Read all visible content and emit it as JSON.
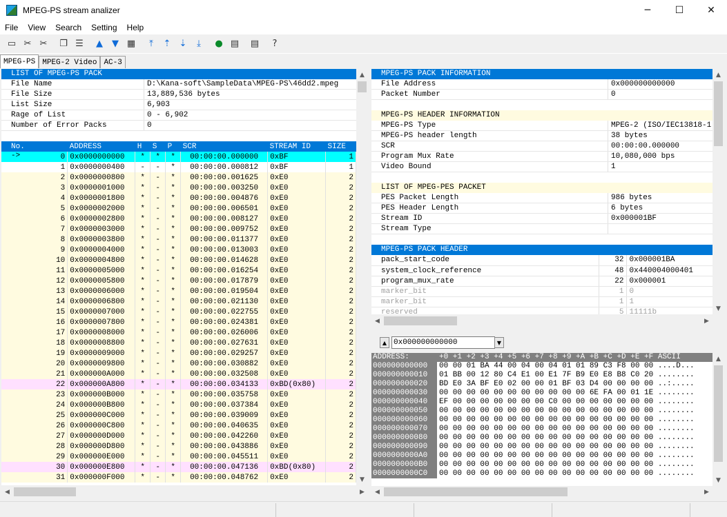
{
  "window": {
    "title": "MPEG-PS stream analizer",
    "minimize": "─",
    "maximize": "☐",
    "close": "✕"
  },
  "menu": [
    "File",
    "View",
    "Search",
    "Setting",
    "Help"
  ],
  "tabs": [
    "MPEG-PS",
    "MPEG-2 Video",
    "AC-3"
  ],
  "list": {
    "header": "LIST OF MPEG-PS PACK",
    "rows": [
      {
        "k": "File Name",
        "v": "D:\\Kana-soft\\SampleData\\MPEG-PS\\46dd2.mpeg"
      },
      {
        "k": "File Size",
        "v": "13,889,536 bytes"
      },
      {
        "k": "List Size",
        "v": "6,903"
      },
      {
        "k": "Rage of List",
        "v": "0 - 6,902"
      },
      {
        "k": "Number of Error Packs",
        "v": "0"
      }
    ]
  },
  "packets": {
    "columns": [
      "No.",
      "ADDRESS",
      "H",
      "S",
      "P",
      "SCR",
      "STREAM ID",
      "SIZE"
    ],
    "rows": [
      {
        "mark": "->",
        "no": "0",
        "addr": "0x0000000000",
        "h": "*",
        "s": "*",
        "p": "*",
        "scr": "00:00:00.000000",
        "sid": "0xBF",
        "size": "1",
        "style": "cur"
      },
      {
        "mark": "",
        "no": "1",
        "addr": "0x0000000400",
        "h": "-",
        "s": "-",
        "p": "*",
        "scr": "00:00:00.000812",
        "sid": "0xBF",
        "size": "1",
        "style": "wht"
      },
      {
        "mark": "",
        "no": "2",
        "addr": "0x0000000800",
        "h": "*",
        "s": "-",
        "p": "*",
        "scr": "00:00:00.001625",
        "sid": "0xE0",
        "size": "2",
        "style": ""
      },
      {
        "mark": "",
        "no": "3",
        "addr": "0x0000001000",
        "h": "*",
        "s": "-",
        "p": "*",
        "scr": "00:00:00.003250",
        "sid": "0xE0",
        "size": "2",
        "style": ""
      },
      {
        "mark": "",
        "no": "4",
        "addr": "0x0000001800",
        "h": "*",
        "s": "-",
        "p": "*",
        "scr": "00:00:00.004876",
        "sid": "0xE0",
        "size": "2",
        "style": ""
      },
      {
        "mark": "",
        "no": "5",
        "addr": "0x0000002000",
        "h": "*",
        "s": "-",
        "p": "*",
        "scr": "00:00:00.006501",
        "sid": "0xE0",
        "size": "2",
        "style": ""
      },
      {
        "mark": "",
        "no": "6",
        "addr": "0x0000002800",
        "h": "*",
        "s": "-",
        "p": "*",
        "scr": "00:00:00.008127",
        "sid": "0xE0",
        "size": "2",
        "style": ""
      },
      {
        "mark": "",
        "no": "7",
        "addr": "0x0000003000",
        "h": "*",
        "s": "-",
        "p": "*",
        "scr": "00:00:00.009752",
        "sid": "0xE0",
        "size": "2",
        "style": ""
      },
      {
        "mark": "",
        "no": "8",
        "addr": "0x0000003800",
        "h": "*",
        "s": "-",
        "p": "*",
        "scr": "00:00:00.011377",
        "sid": "0xE0",
        "size": "2",
        "style": ""
      },
      {
        "mark": "",
        "no": "9",
        "addr": "0x0000004000",
        "h": "*",
        "s": "-",
        "p": "*",
        "scr": "00:00:00.013003",
        "sid": "0xE0",
        "size": "2",
        "style": ""
      },
      {
        "mark": "",
        "no": "10",
        "addr": "0x0000004800",
        "h": "*",
        "s": "-",
        "p": "*",
        "scr": "00:00:00.014628",
        "sid": "0xE0",
        "size": "2",
        "style": ""
      },
      {
        "mark": "",
        "no": "11",
        "addr": "0x0000005000",
        "h": "*",
        "s": "-",
        "p": "*",
        "scr": "00:00:00.016254",
        "sid": "0xE0",
        "size": "2",
        "style": ""
      },
      {
        "mark": "",
        "no": "12",
        "addr": "0x0000005800",
        "h": "*",
        "s": "-",
        "p": "*",
        "scr": "00:00:00.017879",
        "sid": "0xE0",
        "size": "2",
        "style": ""
      },
      {
        "mark": "",
        "no": "13",
        "addr": "0x0000006000",
        "h": "*",
        "s": "-",
        "p": "*",
        "scr": "00:00:00.019504",
        "sid": "0xE0",
        "size": "2",
        "style": ""
      },
      {
        "mark": "",
        "no": "14",
        "addr": "0x0000006800",
        "h": "*",
        "s": "-",
        "p": "*",
        "scr": "00:00:00.021130",
        "sid": "0xE0",
        "size": "2",
        "style": ""
      },
      {
        "mark": "",
        "no": "15",
        "addr": "0x0000007000",
        "h": "*",
        "s": "-",
        "p": "*",
        "scr": "00:00:00.022755",
        "sid": "0xE0",
        "size": "2",
        "style": ""
      },
      {
        "mark": "",
        "no": "16",
        "addr": "0x0000007800",
        "h": "*",
        "s": "-",
        "p": "*",
        "scr": "00:00:00.024381",
        "sid": "0xE0",
        "size": "2",
        "style": ""
      },
      {
        "mark": "",
        "no": "17",
        "addr": "0x0000008000",
        "h": "*",
        "s": "-",
        "p": "*",
        "scr": "00:00:00.026006",
        "sid": "0xE0",
        "size": "2",
        "style": ""
      },
      {
        "mark": "",
        "no": "18",
        "addr": "0x0000008800",
        "h": "*",
        "s": "-",
        "p": "*",
        "scr": "00:00:00.027631",
        "sid": "0xE0",
        "size": "2",
        "style": ""
      },
      {
        "mark": "",
        "no": "19",
        "addr": "0x0000009000",
        "h": "*",
        "s": "-",
        "p": "*",
        "scr": "00:00:00.029257",
        "sid": "0xE0",
        "size": "2",
        "style": ""
      },
      {
        "mark": "",
        "no": "20",
        "addr": "0x0000009800",
        "h": "*",
        "s": "-",
        "p": "*",
        "scr": "00:00:00.030882",
        "sid": "0xE0",
        "size": "2",
        "style": ""
      },
      {
        "mark": "",
        "no": "21",
        "addr": "0x000000A000",
        "h": "*",
        "s": "-",
        "p": "*",
        "scr": "00:00:00.032508",
        "sid": "0xE0",
        "size": "2",
        "style": ""
      },
      {
        "mark": "",
        "no": "22",
        "addr": "0x000000A800",
        "h": "*",
        "s": "-",
        "p": "*",
        "scr": "00:00:00.034133",
        "sid": "0xBD(0x80)",
        "size": "2",
        "style": "pink"
      },
      {
        "mark": "",
        "no": "23",
        "addr": "0x000000B000",
        "h": "*",
        "s": "-",
        "p": "*",
        "scr": "00:00:00.035758",
        "sid": "0xE0",
        "size": "2",
        "style": ""
      },
      {
        "mark": "",
        "no": "24",
        "addr": "0x000000B800",
        "h": "*",
        "s": "-",
        "p": "*",
        "scr": "00:00:00.037384",
        "sid": "0xE0",
        "size": "2",
        "style": ""
      },
      {
        "mark": "",
        "no": "25",
        "addr": "0x000000C000",
        "h": "*",
        "s": "-",
        "p": "*",
        "scr": "00:00:00.039009",
        "sid": "0xE0",
        "size": "2",
        "style": ""
      },
      {
        "mark": "",
        "no": "26",
        "addr": "0x000000C800",
        "h": "*",
        "s": "-",
        "p": "*",
        "scr": "00:00:00.040635",
        "sid": "0xE0",
        "size": "2",
        "style": ""
      },
      {
        "mark": "",
        "no": "27",
        "addr": "0x000000D000",
        "h": "*",
        "s": "-",
        "p": "*",
        "scr": "00:00:00.042260",
        "sid": "0xE0",
        "size": "2",
        "style": ""
      },
      {
        "mark": "",
        "no": "28",
        "addr": "0x000000D800",
        "h": "*",
        "s": "-",
        "p": "*",
        "scr": "00:00:00.043886",
        "sid": "0xE0",
        "size": "2",
        "style": ""
      },
      {
        "mark": "",
        "no": "29",
        "addr": "0x000000E000",
        "h": "*",
        "s": "-",
        "p": "*",
        "scr": "00:00:00.045511",
        "sid": "0xE0",
        "size": "2",
        "style": ""
      },
      {
        "mark": "",
        "no": "30",
        "addr": "0x000000E800",
        "h": "*",
        "s": "-",
        "p": "*",
        "scr": "00:00:00.047136",
        "sid": "0xBD(0x80)",
        "size": "2",
        "style": "pink"
      },
      {
        "mark": "",
        "no": "31",
        "addr": "0x000000F000",
        "h": "*",
        "s": "-",
        "p": "*",
        "scr": "00:00:00.048762",
        "sid": "0xE0",
        "size": "2",
        "style": ""
      }
    ]
  },
  "pack_info": {
    "header": "MPEG-PS PACK INFORMATION",
    "rows": [
      {
        "k": "File Address",
        "v": "0x000000000000"
      },
      {
        "k": "Packet Number",
        "v": "0"
      }
    ]
  },
  "header_info": {
    "header": "MPEG-PS HEADER INFORMATION",
    "rows": [
      {
        "k": "MPEG-PS Type",
        "v": "MPEG-2 (ISO/IEC13818-1)"
      },
      {
        "k": "MPEG-PS header length",
        "v": "38 bytes"
      },
      {
        "k": "SCR",
        "v": "00:00:00.000000"
      },
      {
        "k": "Program Mux Rate",
        "v": "10,080,000 bps"
      },
      {
        "k": "Video Bound",
        "v": "1"
      }
    ]
  },
  "pes_info": {
    "header": "LIST OF MPEG-PES PACKET",
    "rows": [
      {
        "k": "PES Packet Length",
        "v": "986 bytes"
      },
      {
        "k": "PES Header Length",
        "v": "6 bytes"
      },
      {
        "k": "Stream ID",
        "v": "0x000001BF"
      },
      {
        "k": "Stream Type",
        "v": ""
      }
    ]
  },
  "pack_header": {
    "header": "MPEG-PS PACK HEADER",
    "rows": [
      {
        "k": "pack_start_code",
        "bits": "32",
        "v": "0x000001BA",
        "grey": false
      },
      {
        "k": "system_clock_reference",
        "bits": "48",
        "v": "0x440004000401",
        "grey": false
      },
      {
        "k": "program_mux_rate",
        "bits": "22",
        "v": "0x000001",
        "grey": false
      },
      {
        "k": "marker_bit",
        "bits": "1",
        "v": "0",
        "grey": true
      },
      {
        "k": "marker_bit",
        "bits": "1",
        "v": "1",
        "grey": true
      },
      {
        "k": "reserved",
        "bits": "5",
        "v": "11111b",
        "grey": true
      }
    ]
  },
  "address_bar": {
    "value": "0x000000000000"
  },
  "hexdump": {
    "header_addr": "ADDRESS:",
    "header_cols": "+0 +1 +2 +3 +4 +5 +6 +7 +8 +9 +A +B +C +D +E +F ASCII",
    "rows": [
      {
        "addr": "000000000000",
        "data": "00 00 01 BA 44 00 04 00 04 01 01 89 C3 F8 00 00 ....D..."
      },
      {
        "addr": "000000000010",
        "data": "01 BB 00 12 80 C4 E1 00 E1 7F B9 E0 E8 B8 C0 20 ........"
      },
      {
        "addr": "000000000020",
        "data": "BD E0 3A BF E0 02 00 00 01 BF 03 D4 00 00 00 00 ..:....."
      },
      {
        "addr": "000000000030",
        "data": "00 00 00 00 00 00 00 00 00 00 00 6E FA 00 01 1E ........"
      },
      {
        "addr": "000000000040",
        "data": "EF 00 00 00 00 00 00 00 C0 00 00 00 00 00 00 00 ........"
      },
      {
        "addr": "000000000050",
        "data": "00 00 00 00 00 00 00 00 00 00 00 00 00 00 00 00 ........"
      },
      {
        "addr": "000000000060",
        "data": "00 00 00 00 00 00 00 00 00 00 00 00 00 00 00 00 ........"
      },
      {
        "addr": "000000000070",
        "data": "00 00 00 00 00 00 00 00 00 00 00 00 00 00 00 00 ........"
      },
      {
        "addr": "000000000080",
        "data": "00 00 00 00 00 00 00 00 00 00 00 00 00 00 00 00 ........"
      },
      {
        "addr": "000000000090",
        "data": "00 00 00 00 00 00 00 00 00 00 00 00 00 00 00 00 ........"
      },
      {
        "addr": "0000000000A0",
        "data": "00 00 00 00 00 00 00 00 00 00 00 00 00 00 00 00 ........"
      },
      {
        "addr": "0000000000B0",
        "data": "00 00 00 00 00 00 00 00 00 00 00 00 00 00 00 00 ........"
      },
      {
        "addr": "0000000000C0",
        "data": "00 00 00 00 00 00 00 00 00 00 00 00 00 00 00 00 ........"
      }
    ]
  }
}
